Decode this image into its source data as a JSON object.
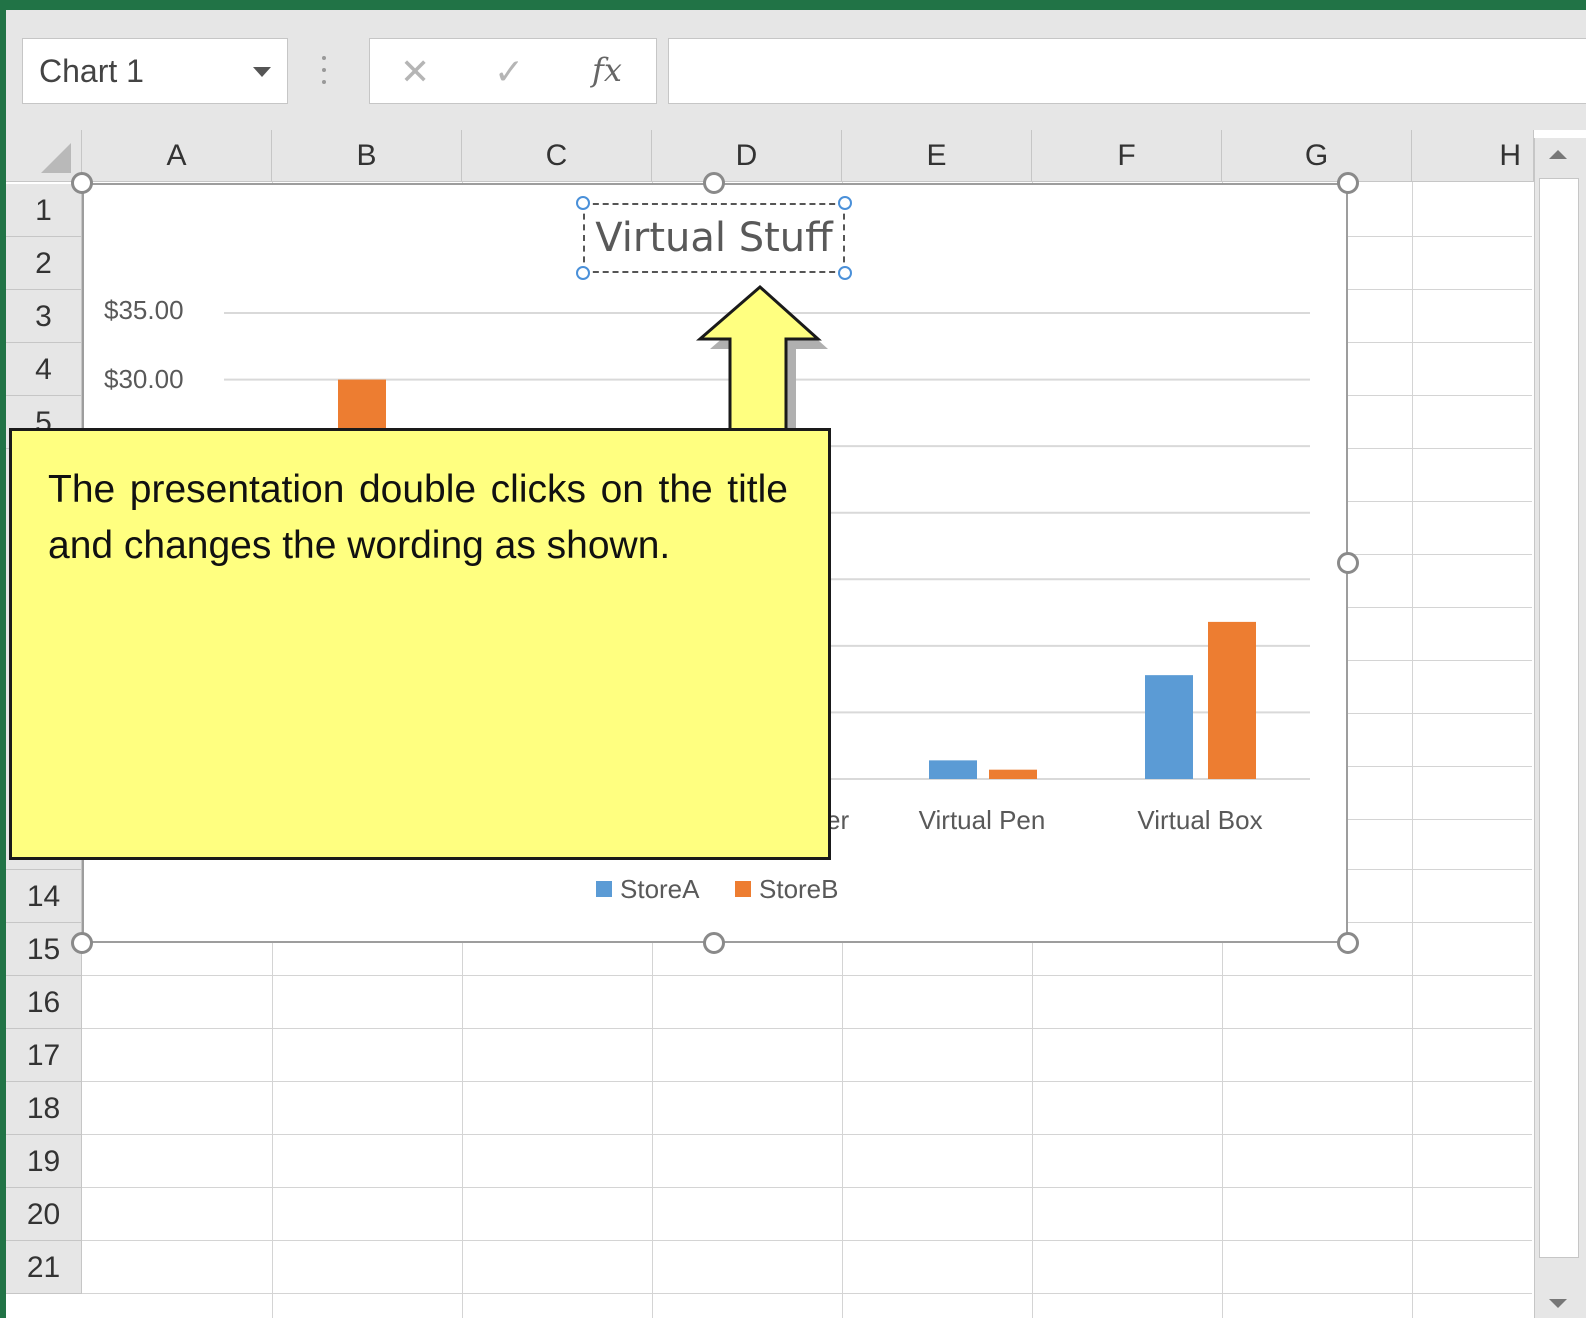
{
  "formula_bar": {
    "name_box": "Chart 1",
    "cancel_icon": "✕",
    "enter_icon": "✓",
    "fx_label": "fx",
    "formula_value": ""
  },
  "columns": [
    "A",
    "B",
    "C",
    "D",
    "E",
    "F",
    "G",
    "H"
  ],
  "rows": [
    "1",
    "2",
    "3",
    "4",
    "5",
    "14",
    "15",
    "16",
    "17",
    "18",
    "19",
    "20",
    "21"
  ],
  "chart_data": {
    "type": "bar",
    "title": "Virtual Stuff",
    "categories_visible": [
      "er",
      "Virtual Pen",
      "Virtual Box"
    ],
    "y_tick_labels_visible": [
      "$35.00",
      "$30.00"
    ],
    "ylim": [
      0,
      35
    ],
    "grid": true,
    "legend": "bottom",
    "series": [
      {
        "name": "StoreA",
        "color": "#5b9bd5"
      },
      {
        "name": "StoreB",
        "color": "#ed7d31"
      }
    ],
    "visible_values": {
      "store_b_first_category": 30,
      "virtual_pen": {
        "StoreA": 1.4,
        "StoreB": 0.7
      },
      "virtual_box": {
        "StoreA": 7.8,
        "StoreB": 11.8
      }
    }
  },
  "callout": {
    "text": "The presentation double clicks on the title and changes the wording as shown."
  }
}
